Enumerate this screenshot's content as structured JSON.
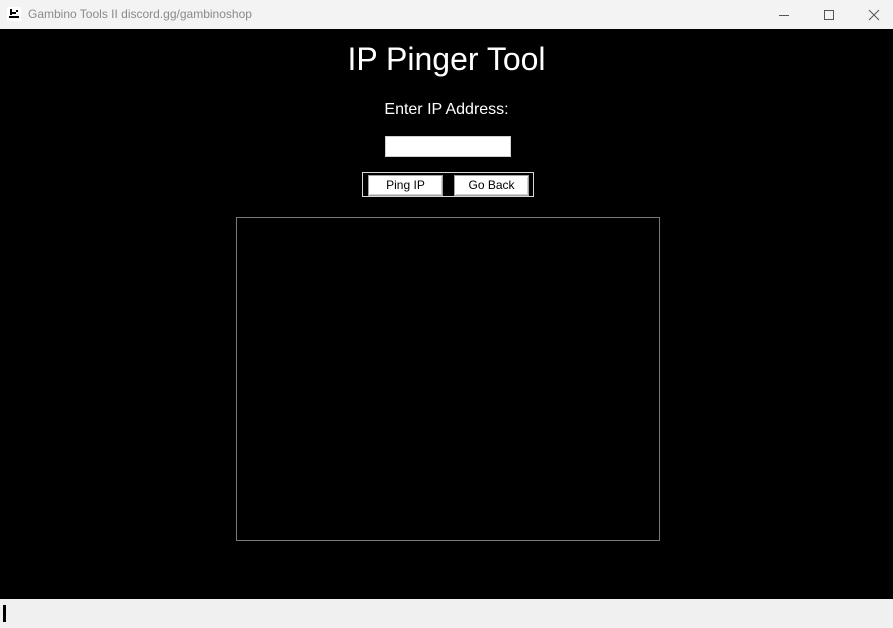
{
  "window": {
    "title": "Gambino Tools II discord.gg/gambinoshop",
    "icon": "app-logo-icon",
    "controls": {
      "minimize": "minimize-icon",
      "maximize": "maximize-icon",
      "close": "close-icon"
    }
  },
  "main": {
    "title": "IP Pinger Tool",
    "ip_label": "Enter IP Address:",
    "ip_input_value": "",
    "ping_button_label": "Ping IP",
    "back_button_label": "Go Back",
    "output_text": ""
  },
  "colors": {
    "background": "#000000",
    "text": "#ffffff",
    "titlebar": "#f3f3f3",
    "output_border": "#7a7a7a"
  }
}
